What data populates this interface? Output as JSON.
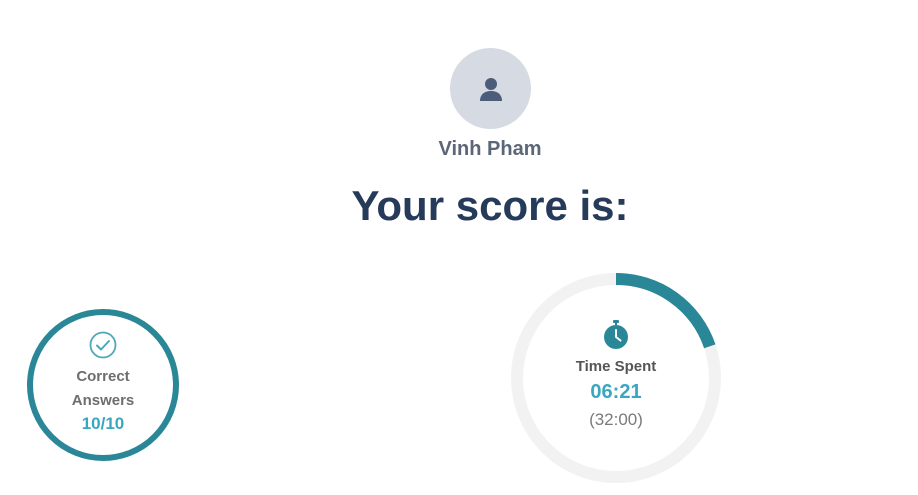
{
  "user": {
    "name": "Vinh Pham",
    "avatar_icon": "user-silhouette-icon"
  },
  "result": {
    "heading": "Your score is:"
  },
  "correct_answers": {
    "label": "Correct Answers",
    "value": "10/10",
    "fraction": 1.0,
    "icon": "check-circle-icon"
  },
  "time": {
    "label": "Time Spent",
    "value": "06:21",
    "limit": "(32:00)",
    "fraction": 0.198,
    "icon": "stopwatch-icon"
  },
  "colors": {
    "accent": "#2a8797",
    "value_text": "#3aa7c0",
    "track": "#f2f2f2",
    "heading": "#263a5a",
    "avatar_bg": "#d6dae2"
  }
}
